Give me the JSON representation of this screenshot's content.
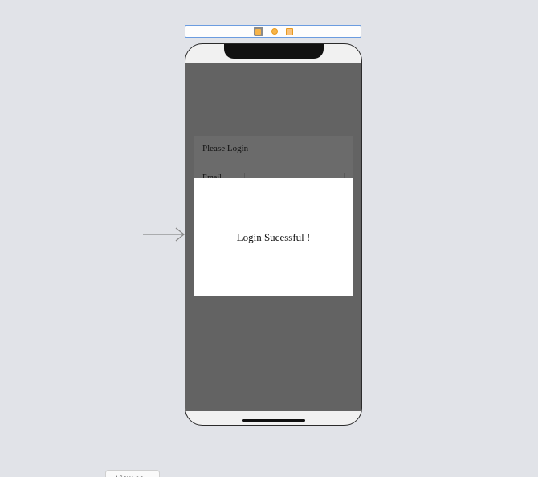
{
  "login": {
    "title": "Please Login",
    "email_label": "Email"
  },
  "alert": {
    "message": "Login Sucessful !"
  },
  "toolbar": {
    "button_label": "View as"
  },
  "colors": {
    "canvas": "#e1e3e8",
    "dimmed_screen": "#636363",
    "alert_background": "#ffffff",
    "selection": "#6b9ce0",
    "dock_icon": "#f7b449"
  },
  "icons": {
    "dock": [
      "view-controller-icon",
      "first-responder-icon",
      "exit-icon"
    ],
    "entry": "entry-point-arrow-icon"
  }
}
